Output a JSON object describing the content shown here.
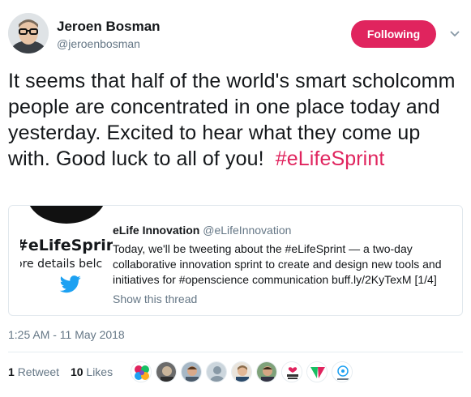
{
  "author": {
    "name": "Jeroen Bosman",
    "handle": "@jeroenbosman"
  },
  "follow_button": {
    "label": "Following"
  },
  "tweet": {
    "text": "It seems that half of the world's smart scholcomm people are concentrated in one place today and yesterday. Excited to hear what they come up with. Good luck to all of you!",
    "hashtag": "#eLifeSprint"
  },
  "quoted": {
    "image_line1": "#eLifeSprint",
    "image_line2": "ore details belc",
    "name": "eLife Innovation",
    "handle": "@eLifeInnovation",
    "text": "Today, we'll be tweeting about the #eLifeSprint — a two-day collaborative innovation sprint to create and design new tools and initiatives for #openscience communication buff.ly/2KyTexM [1/4]",
    "show_thread": "Show this thread"
  },
  "timestamp": "1:25 AM - 11 May 2018",
  "stats": {
    "retweets_count": "1",
    "retweets_label": "Retweet",
    "likes_count": "10",
    "likes_label": "Likes"
  },
  "likers": [
    {
      "name": "avatar-colorful"
    },
    {
      "name": "avatar-photo"
    },
    {
      "name": "avatar-person"
    },
    {
      "name": "avatar-default"
    },
    {
      "name": "avatar-person"
    },
    {
      "name": "avatar-person"
    },
    {
      "name": "avatar-open-access"
    },
    {
      "name": "avatar-logo"
    },
    {
      "name": "avatar-force11"
    }
  ],
  "colors": {
    "accent": "#e0245e",
    "text": "#14171a",
    "muted": "#657786",
    "border": "#e1e8ed",
    "twitter_blue": "#1da1f2"
  }
}
